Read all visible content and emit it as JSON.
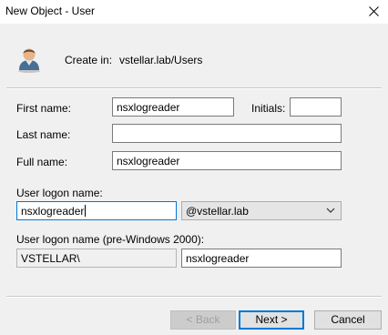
{
  "window": {
    "title": "New Object - User"
  },
  "header": {
    "create_in_label": "Create in:",
    "create_in_path": "vstellar.lab/Users"
  },
  "form": {
    "first_name": {
      "label": "First name:",
      "value": "nsxlogreader"
    },
    "initials": {
      "label": "Initials:",
      "value": ""
    },
    "last_name": {
      "label": "Last name:",
      "value": ""
    },
    "full_name": {
      "label": "Full name:",
      "value": "nsxlogreader"
    },
    "logon": {
      "label": "User logon name:",
      "value": "nsxlogreader",
      "domain": "@vstellar.lab"
    },
    "pre2000": {
      "label": "User logon name (pre-Windows 2000):",
      "domain_prefix": "VSTELLAR\\",
      "value": "nsxlogreader"
    }
  },
  "buttons": {
    "back": "< Back",
    "next": "Next >",
    "cancel": "Cancel"
  },
  "icons": {
    "close": "close-icon",
    "user": "user-icon",
    "dropdown": "chevron-down-icon"
  },
  "colors": {
    "focus_border": "#0078d7",
    "window_bg": "#f0f0f0"
  }
}
